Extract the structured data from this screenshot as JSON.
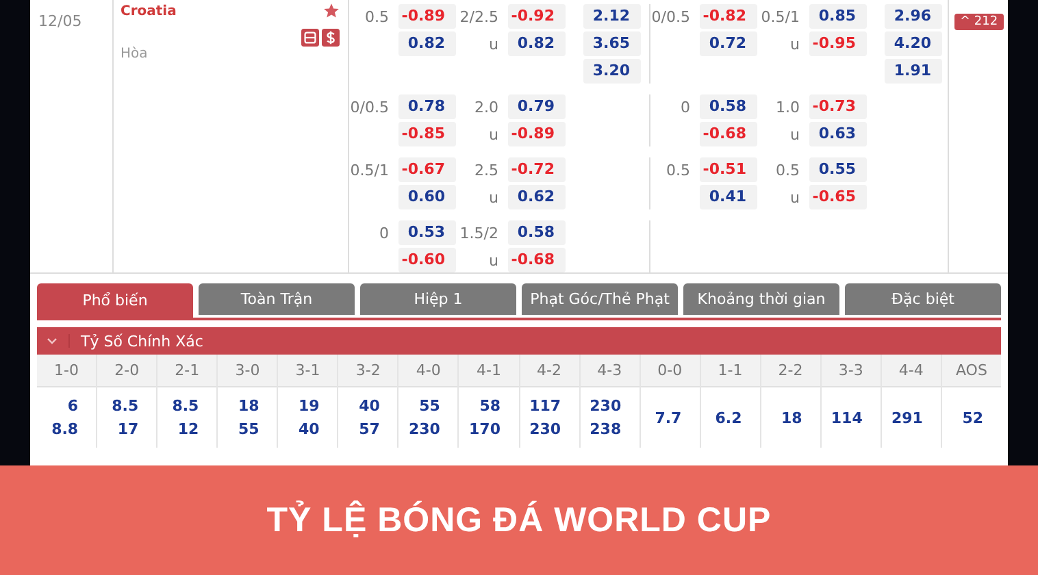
{
  "match": {
    "date": "12/05",
    "home_team": "Croatia",
    "draw_label": "Hòa",
    "favorite": true,
    "count_button": "^ 212"
  },
  "odds_groups": [
    {
      "ft": {
        "hdp": {
          "line": "0.5",
          "values": [
            "-0.89",
            "0.82"
          ]
        },
        "ou": {
          "line": "2/2.5",
          "under_label": "u",
          "values": [
            "-0.92",
            "0.82"
          ]
        },
        "x12": [
          "2.12",
          "3.65",
          "3.20"
        ]
      },
      "ht": {
        "hdp": {
          "line": "0/0.5",
          "values": [
            "-0.82",
            "0.72"
          ]
        },
        "ou": {
          "line": "0.5/1",
          "under_label": "u",
          "values": [
            "0.85",
            "-0.95"
          ]
        },
        "x12": [
          "2.96",
          "4.20",
          "1.91"
        ]
      }
    },
    {
      "ft": {
        "hdp": {
          "line": "0/0.5",
          "values": [
            "0.78",
            "-0.85"
          ]
        },
        "ou": {
          "line": "2.0",
          "under_label": "u",
          "values": [
            "0.79",
            "-0.89"
          ]
        }
      },
      "ht": {
        "hdp": {
          "line": "0",
          "values": [
            "0.58",
            "-0.68"
          ]
        },
        "ou": {
          "line": "1.0",
          "under_label": "u",
          "values": [
            "-0.73",
            "0.63"
          ]
        }
      }
    },
    {
      "ft": {
        "hdp": {
          "line": "0.5/1",
          "values": [
            "-0.67",
            "0.60"
          ]
        },
        "ou": {
          "line": "2.5",
          "under_label": "u",
          "values": [
            "-0.72",
            "0.62"
          ]
        }
      },
      "ht": {
        "hdp": {
          "line": "0.5",
          "values": [
            "-0.51",
            "0.41"
          ]
        },
        "ou": {
          "line": "0.5",
          "under_label": "u",
          "values": [
            "0.55",
            "-0.65"
          ]
        }
      }
    },
    {
      "ft": {
        "hdp": {
          "line": "0",
          "values": [
            "0.53",
            "-0.60"
          ]
        },
        "ou": {
          "line": "1.5/2",
          "under_label": "u",
          "values": [
            "0.58",
            "-0.68"
          ]
        }
      }
    }
  ],
  "tabs": [
    {
      "label": "Phổ biến",
      "selected": true
    },
    {
      "label": "Toàn Trận",
      "selected": false
    },
    {
      "label": "Hiệp 1",
      "selected": false
    },
    {
      "label": "Phạt Góc/Thẻ Phạt",
      "selected": false
    },
    {
      "label": "Khoảng thời gian",
      "selected": false
    },
    {
      "label": "Đặc biệt",
      "selected": false
    }
  ],
  "section": {
    "title": "Tỷ Số Chính Xác",
    "expanded": true
  },
  "scores": [
    {
      "label": "1-0",
      "values": [
        "6",
        "8.8"
      ]
    },
    {
      "label": "2-0",
      "values": [
        "8.5",
        "17"
      ]
    },
    {
      "label": "2-1",
      "values": [
        "8.5",
        "12"
      ]
    },
    {
      "label": "3-0",
      "values": [
        "18",
        "55"
      ]
    },
    {
      "label": "3-1",
      "values": [
        "19",
        "40"
      ]
    },
    {
      "label": "3-2",
      "values": [
        "40",
        "57"
      ]
    },
    {
      "label": "4-0",
      "values": [
        "55",
        "230"
      ]
    },
    {
      "label": "4-1",
      "values": [
        "58",
        "170"
      ]
    },
    {
      "label": "4-2",
      "values": [
        "117",
        "230"
      ]
    },
    {
      "label": "4-3",
      "values": [
        "230",
        "238"
      ]
    },
    {
      "label": "0-0",
      "values": [
        "7.7"
      ]
    },
    {
      "label": "1-1",
      "values": [
        "6.2"
      ]
    },
    {
      "label": "2-2",
      "values": [
        "18"
      ]
    },
    {
      "label": "3-3",
      "values": [
        "114"
      ]
    },
    {
      "label": "4-4",
      "values": [
        "291"
      ]
    },
    {
      "label": "AOS",
      "values": [
        "52"
      ]
    }
  ],
  "banner": {
    "title": "TỶ LỆ BÓNG ĐÁ WORLD CUP"
  }
}
